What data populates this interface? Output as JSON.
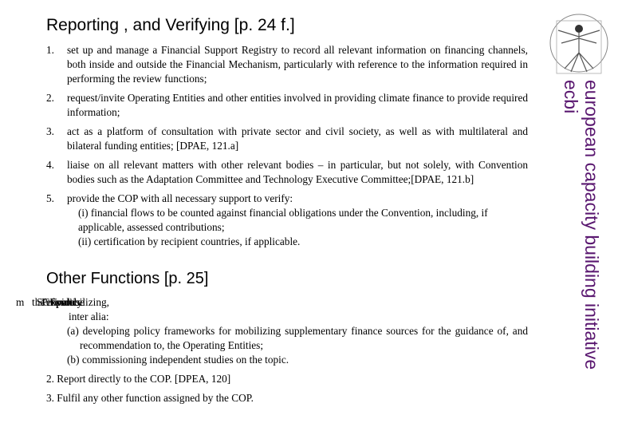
{
  "title": "Reporting , and Verifying [p. 24 f.]",
  "items": [
    {
      "n": "1.",
      "t": "set up and manage a Financial Support Registry to record all relevant information on financing channels, both inside and outside the Financial Mechanism, particularly with reference to the information required in performing the review functions;"
    },
    {
      "n": "2.",
      "t": "request/invite Operating Entities and other entities involved in providing climate finance to provide required information;"
    },
    {
      "n": "3.",
      "t": "act as a platform of consultation with private sector and civil society, as well as with multilateral and bilateral funding entities; [DPAE, 121.a]"
    },
    {
      "n": "4.",
      "t": "liaise on all relevant matters with other relevant bodies – in particular, but not solely, with Convention bodies such as the Adaptation Committee and Technology Executive Committee;[DPAE, 121.b]"
    },
    {
      "n": "5.",
      "t": "provide the COP with all necessary support to verify:",
      "subs": [
        "(i) financial flows to be counted against financial obligations under the Convention, including, if applicable, assessed contributions;",
        "(ii)  certification by recipient countries, if applicable."
      ]
    }
  ],
  "other": {
    "heading": "Other Functions  [p. 25]",
    "garbled": [
      "m",
      "the",
      "SCF",
      "Provide",
      "expertise",
      "finance",
      "policy",
      "mobilizing,"
    ],
    "inter": "inter alia:",
    "a": "(a) developing policy frameworks for mobilizing supplementary finance sources for the guidance of, and recommendation to, the Operating Entities;",
    "b": "(b) commissioning independent studies on the topic.",
    "two": "2. Report directly to the COP. [DPEA, 120]",
    "three": "3. Fulfil any other function assigned by the COP."
  },
  "side": {
    "line1": "european capacity building initiative",
    "line2": "ecbi",
    "color": "#5a1870"
  }
}
